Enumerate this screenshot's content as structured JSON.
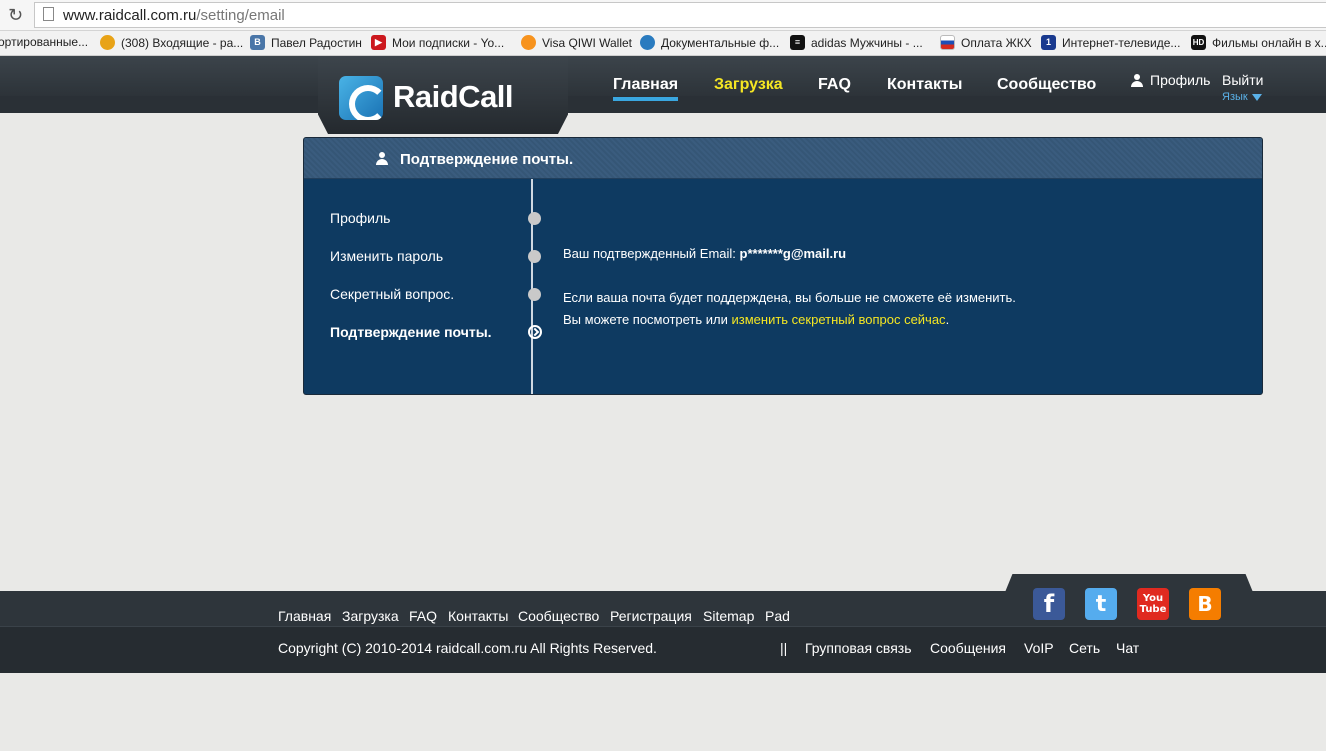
{
  "browser": {
    "url_domain": "www.raidcall.com.ru",
    "url_path": "/setting/email",
    "bookmarks": [
      {
        "label": "ортированные...",
        "icon": "folder-icon"
      },
      {
        "label": "(308) Входящие - ра...",
        "icon": "mail-icon"
      },
      {
        "label": "Павел Радостин",
        "icon": "vk-icon"
      },
      {
        "label": "Мои подписки - Yo...",
        "icon": "youtube-icon"
      },
      {
        "label": "Visa QIWI Wallet",
        "icon": "qiwi-icon"
      },
      {
        "label": "Документальные ф...",
        "icon": "film-icon"
      },
      {
        "label": "adidas Мужчины - ...",
        "icon": "adidas-icon"
      },
      {
        "label": "Оплата ЖКХ",
        "icon": "russia-flag-icon"
      },
      {
        "label": "Интернет-телевиде...",
        "icon": "channel-one-icon"
      },
      {
        "label": "Фильмы онлайн в х...",
        "icon": "hd-icon"
      }
    ]
  },
  "site": {
    "logo_text": "RaidCall",
    "nav": {
      "home": "Главная",
      "download": "Загрузка",
      "faq": "FAQ",
      "contacts": "Контакты",
      "community": "Сообщество"
    },
    "profile": "Профиль",
    "logout": "Выйти",
    "language": "Язык"
  },
  "panel": {
    "title": "Подтверждение почты.",
    "sidebar": [
      {
        "label": "Профиль"
      },
      {
        "label": "Изменить пароль"
      },
      {
        "label": "Секретный вопрос."
      },
      {
        "label": "Подтверждение почты."
      }
    ],
    "confirmed_label": "Ваш подтвержденный Email:",
    "confirmed_email": "p*******g@mail.ru",
    "notice_line1": "Если ваша почта будет поддерждена, вы больше не сможете её изменить.",
    "notice_line2_prefix": "Вы можете посмотреть или",
    "notice_link": "изменить секретный вопрос сейчас",
    "notice_suffix": "."
  },
  "footer": {
    "links": [
      "Главная",
      "Загрузка",
      "FAQ",
      "Контакты",
      "Сообщество",
      "Регистрация",
      "Sitemap",
      "Pad"
    ],
    "copyright": "Copyright (C) 2010-2014 raidcall.com.ru All Rights Reserved.",
    "separator": "||",
    "links2": [
      "Групповая связь",
      "Сообщения",
      "VoIP",
      "Сеть",
      "Чат"
    ],
    "social": [
      {
        "glyph": "f",
        "icon": "facebook-icon",
        "color": "#3b5998"
      },
      {
        "glyph": "t",
        "icon": "twitter-icon",
        "color": "#55acee"
      },
      {
        "glyph": "You",
        "icon": "youtube-icon",
        "color": "#e02a20"
      },
      {
        "glyph": "B",
        "icon": "blogger-icon",
        "color": "#f57d00"
      }
    ]
  }
}
